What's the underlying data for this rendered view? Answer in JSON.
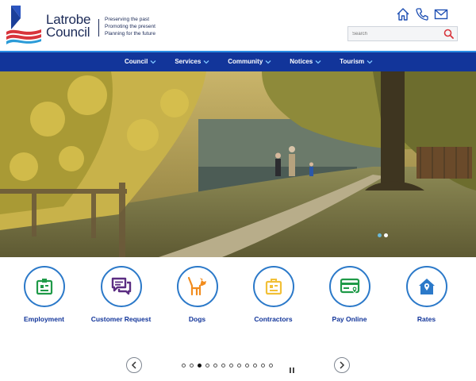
{
  "brand": {
    "name_line1": "Latrobe",
    "name_line2": "Council",
    "tagline": [
      "Preserving the past",
      "Promoting the present",
      "Planning for the future"
    ]
  },
  "top_icons": [
    "home-icon",
    "phone-icon",
    "mail-icon"
  ],
  "search": {
    "placeholder": "Search",
    "icon": "search-icon"
  },
  "nav": {
    "items": [
      {
        "label": "Council"
      },
      {
        "label": "Services"
      },
      {
        "label": "Community"
      },
      {
        "label": "Notices"
      },
      {
        "label": "Tourism"
      }
    ]
  },
  "hero": {
    "slide_count": 2,
    "active_slide": 1
  },
  "quick_links": [
    {
      "label": "Employment",
      "icon": "employment-icon",
      "color": "#1f9a48"
    },
    {
      "label": "Customer Request",
      "icon": "chat-icon",
      "color": "#5b2d82"
    },
    {
      "label": "Dogs",
      "icon": "dog-icon",
      "color": "#f28c1e"
    },
    {
      "label": "Contractors",
      "icon": "contractor-icon",
      "color": "#f2c037"
    },
    {
      "label": "Pay Online",
      "icon": "card-icon",
      "color": "#1f9a48"
    },
    {
      "label": "Rates",
      "icon": "house-rates-icon",
      "color": "#2b79c9"
    }
  ],
  "carousel": {
    "dot_count": 12,
    "active_dot": 3
  },
  "colors": {
    "brand_navy": "#1b2a57",
    "nav_blue": "#12359a",
    "nav_border": "#2a8de4",
    "accent_red": "#d8343b",
    "ring_blue": "#2b79c9"
  }
}
